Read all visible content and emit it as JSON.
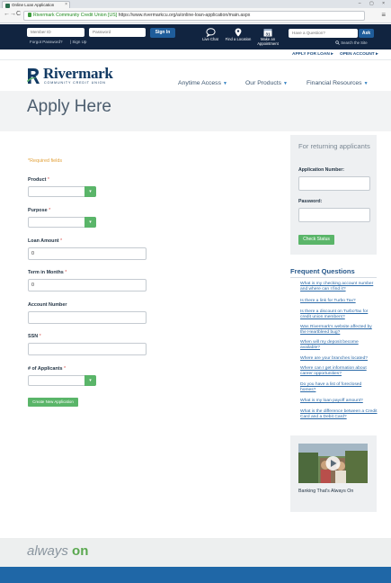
{
  "browser": {
    "tab_title": "Online Loan Application",
    "tab_close": "×",
    "window_controls": "– ▢ ×",
    "back_glyph": "←",
    "forward_glyph": "→",
    "reload_glyph": "C",
    "cert_name": "Rivermark Community Credit Union [US]",
    "url": "https://www.rivermarkcu.org/a/online-loan-application/main.aspx",
    "menu_glyph": "≡"
  },
  "header": {
    "member_id_placeholder": "Member ID",
    "password_placeholder": "Password",
    "sign_in_label": "Sign In",
    "forgot_password": "Forgot Password?",
    "sign_up": "| Sign Up",
    "live_chat": "Live Chat",
    "find_location": "Find a Location",
    "make_appointment": "Make an Appointment",
    "calendar_day": "31",
    "question_placeholder": "Have a Question?",
    "ask_label": "Ask",
    "search_site": "Search the Site"
  },
  "secondary_links": {
    "apply_for_loan": "APPLY FOR LOAN",
    "open_account": "OPEN ACCOUNT",
    "caret": "▸"
  },
  "brand": {
    "name": "Rivermark",
    "subtitle": "COMMUNITY CREDIT UNION",
    "color_navy": "#123a63",
    "color_green": "#5ab569",
    "color_topbar": "#112440"
  },
  "mainnav": {
    "items": [
      {
        "label": "Anytime Access",
        "chevron": "▼"
      },
      {
        "label": "Our Products",
        "chevron": "▼"
      },
      {
        "label": "Financial Resources",
        "chevron": "▼"
      }
    ]
  },
  "page": {
    "title": "Apply Here"
  },
  "form": {
    "required_note": "*Required fields",
    "star": "*",
    "select_glyph": "▾",
    "product_label": "Product",
    "purpose_label": "Purpose",
    "loan_amount_label": "Loan Amount",
    "loan_amount_value": "0",
    "term_label": "Term in Months",
    "term_value": "0",
    "account_number_label": "Account Number",
    "ssn_label": "SSN",
    "applicants_label": "# of Applicants",
    "create_button": "Create New Application"
  },
  "returning": {
    "title": "For returning applicants",
    "application_number_label": "Application Number:",
    "password_label": "Password:",
    "check_status": "Check Status"
  },
  "faq": {
    "title": "Frequent Questions",
    "items": [
      "What is my checking account number and where can I find it?",
      "Is there a link for Turbo Tax?",
      "Is there a discount on TurboTax for credit union members?",
      "Was Rivermark's website affected by the Heartbleed bug?",
      "When will my deposit become available?",
      "Where are your branches located?",
      "Where can I get information about career opportunities?",
      "Do you have a list of foreclosed homes?",
      "What is my loan payoff amount?",
      "What is the difference between a Credit Card and a Debit Card?"
    ]
  },
  "video": {
    "caption": "Banking That's Always On"
  },
  "footer": {
    "tagline_prefix": "always",
    "tagline_on": "on"
  }
}
